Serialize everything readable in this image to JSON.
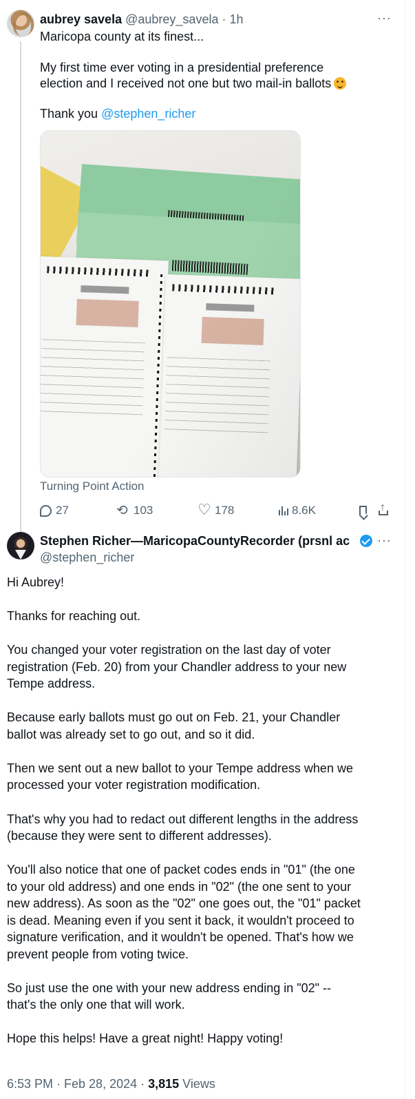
{
  "tweet1": {
    "author_name": "aubrey savela",
    "handle": "@aubrey_savela",
    "time": "1h",
    "text_line1": "Maricopa county at its finest...",
    "text_line2": "My first time ever voting in a presidential preference",
    "text_line3": "election and I received not one but two mail-in ballots",
    "thanks_prefix": "Thank you ",
    "thanks_mention": "@stephen_richer",
    "source_label": "Turning Point Action",
    "replies": "27",
    "retweets": "103",
    "likes": "178",
    "views": "8.6K"
  },
  "tweet2": {
    "author_name": "Stephen Richer—MaricopaCountyRecorder (prsnl ac",
    "handle": "@stephen_richer",
    "lines": [
      "Hi Aubrey!",
      "Thanks for reaching out.",
      "You changed your voter registration on the last day of voter",
      "registration (Feb. 20) from your Chandler address to your new",
      "Tempe address.",
      "Because early ballots must go out on Feb. 21, your Chandler",
      "ballot was already set to go out, and so it did.",
      "Then we sent out a new ballot to your Tempe address when we",
      "processed your voter registration modification.",
      "That's why you had to redact out different lengths in the address",
      "(because they were sent to different addresses).",
      "You'll also notice that one of packet codes ends in \"01\" (the one",
      "to your old address) and one ends in \"02\" (the one sent to your",
      "new address).  As soon as the \"02\" one goes out, the \"01\" packet",
      "is dead.  Meaning even if you sent it back, it wouldn't proceed to",
      "signature verification, and it wouldn't be opened.  That's how we",
      "prevent people from voting twice.",
      "So just use the one with your new address ending in \"02\" --",
      "that's the only one that will work.",
      "Hope this helps!  Have a great night!  Happy voting!"
    ],
    "timestamp": "6:53 PM · Feb 28, 2024 · ",
    "views_count": "3,815",
    "views_label": " Views"
  },
  "colors": {
    "accent": "#1d9bf0",
    "secondary_text": "#536471"
  }
}
